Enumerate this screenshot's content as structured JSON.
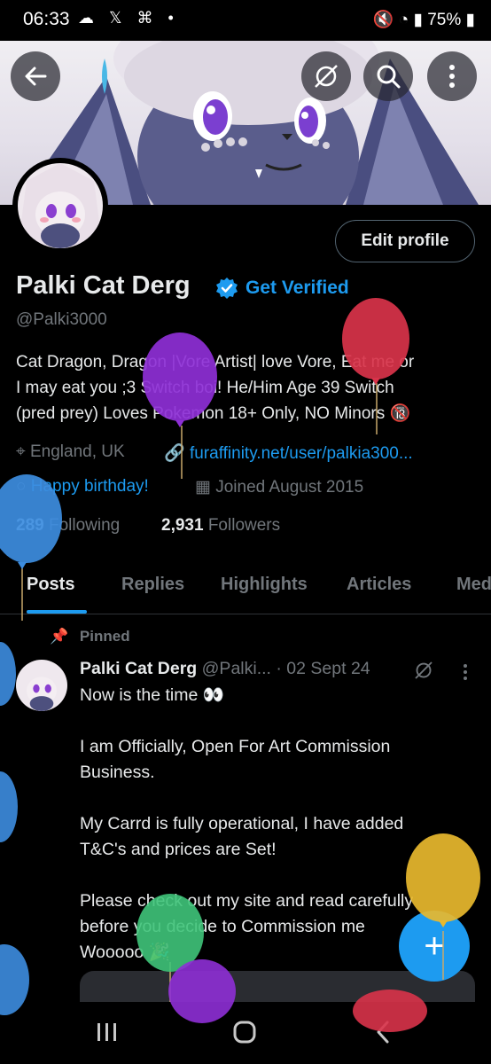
{
  "status_bar": {
    "time": "06:33",
    "notification_icons": [
      "cloud-icon",
      "x-icon",
      "game-icon",
      "dot-icon"
    ],
    "battery": "75%"
  },
  "profile": {
    "name": "Palki Cat Derg",
    "get_verified": "Get Verified",
    "handle": "@Palki3000",
    "edit_profile": "Edit profile",
    "bio_line1": "Cat Dragon, Dragon |Vore Artist| love Vore, Eat me or",
    "bio_line2": "I may eat you ;3 Switch boi! He/Him Age 39 Switch",
    "bio_line3": "(pred prey) Loves Pokemon 18+ Only, NO Minors 🔞",
    "location": "England, UK",
    "website": "furaffinity.net/user/palkia300...",
    "birthday": "Happy birthday!",
    "joined": "Joined August 2015",
    "following_count": "289",
    "following_label": "Following",
    "followers_count": "2,931",
    "followers_label": "Followers"
  },
  "tabs": [
    "Posts",
    "Replies",
    "Highlights",
    "Articles",
    "Media"
  ],
  "active_tab": "Posts",
  "pinned_post": {
    "pinned_label": "Pinned",
    "author": "Palki Cat Derg",
    "handle": "@Palki...",
    "date": "· 02 Sept 24",
    "line1": "Now is the time 👀",
    "line2": "I am Officially, Open For Art Commission",
    "line3": "Business.",
    "line4": "My Carrd is fully operational, I have added",
    "line5": "T&C's and prices are Set!",
    "line6": "Please check out my site and read carefully",
    "line7": "before you decide to Commission me",
    "line8": "Wooooo 🎉"
  },
  "fab_label": "+",
  "colors": {
    "accent": "#1d9bf0",
    "background": "#000000",
    "text": "#e7e9ea",
    "muted": "#71767b",
    "balloon_purple": "#8e2fd6",
    "balloon_red": "#d9334a",
    "balloon_blue": "#3d8de0",
    "balloon_yellow": "#e8b92e",
    "balloon_green": "#3fc47a"
  }
}
